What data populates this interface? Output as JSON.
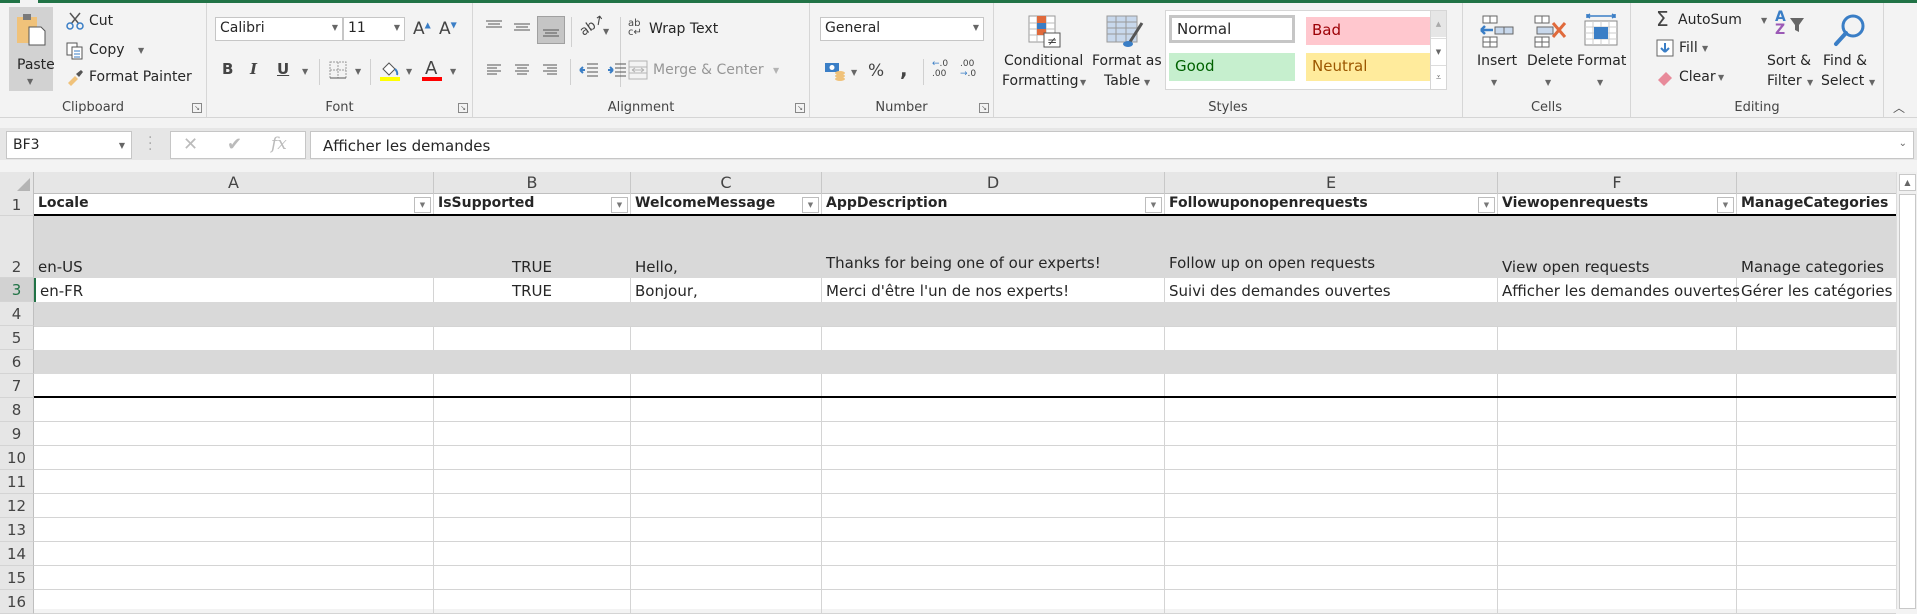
{
  "ribbon": {
    "clipboard": {
      "label": "Clipboard",
      "paste": "Paste",
      "cut": "Cut",
      "copy": "Copy",
      "format_painter": "Format Painter"
    },
    "font": {
      "label": "Font",
      "font_name": "Calibri",
      "font_size": "11",
      "bold": "B",
      "italic": "I",
      "underline": "U",
      "highlight_color": "#ffff00",
      "font_color": "#ff0000"
    },
    "alignment": {
      "label": "Alignment",
      "wrap_text": "Wrap Text",
      "merge_center": "Merge & Center"
    },
    "number": {
      "label": "Number",
      "format": "General",
      "percent": "%",
      "comma": ","
    },
    "styles": {
      "label": "Styles",
      "conditional_formatting": [
        "Conditional",
        "Formatting"
      ],
      "format_as_table": [
        "Format as",
        "Table"
      ],
      "cell_styles": [
        {
          "name": "Normal",
          "bg": "#ffffff",
          "fg": "#000000"
        },
        {
          "name": "Bad",
          "bg": "#ffc7ce",
          "fg": "#9c0006"
        },
        {
          "name": "Good",
          "bg": "#c6efce",
          "fg": "#006100"
        },
        {
          "name": "Neutral",
          "bg": "#ffeb9c",
          "fg": "#9c5700"
        }
      ]
    },
    "cells": {
      "label": "Cells",
      "insert": "Insert",
      "delete": "Delete",
      "format": "Format"
    },
    "editing": {
      "label": "Editing",
      "autosum": "AutoSum",
      "fill": "Fill",
      "clear": "Clear",
      "sort_filter": [
        "Sort &",
        "Filter"
      ],
      "find_select": [
        "Find &",
        "Select"
      ]
    }
  },
  "formula_bar": {
    "name_box": "BF3",
    "formula": "Afficher les demandes"
  },
  "sheet": {
    "column_letters": [
      "A",
      "B",
      "C",
      "D",
      "E",
      "F",
      ""
    ],
    "headers": [
      "Locale",
      "IsSupported",
      "WelcomeMessage",
      "AppDescription",
      "Followuponopenrequests",
      "Viewopenrequests",
      "ManageCategories"
    ],
    "rows": [
      [
        "en-US",
        "TRUE",
        "Hello,",
        "Thanks for being one of our experts!",
        "Follow up on open requests",
        "View open requests",
        "Manage categories"
      ],
      [
        "en-FR",
        "TRUE",
        "Bonjour,",
        "Merci d'être l'un de nos experts!",
        "Suivi des demandes ouvertes",
        "Afficher les demandes ouvertes",
        "Gérer les catégories"
      ]
    ],
    "row_numbers": [
      "1",
      "2",
      "3",
      "4",
      "5",
      "6",
      "7",
      "8",
      "9",
      "10",
      "11",
      "12",
      "13",
      "14",
      "15",
      "16"
    ],
    "selected_row": "3"
  }
}
